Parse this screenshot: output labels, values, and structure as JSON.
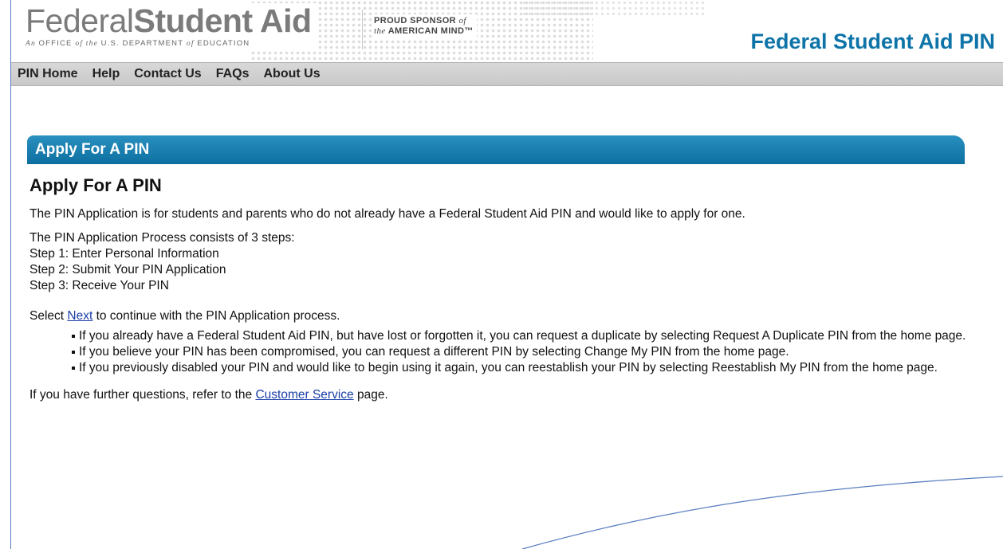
{
  "header": {
    "logo_federal": "Federal",
    "logo_student_aid": "Student Aid",
    "logo_subtitle_parts": [
      "An ",
      "OFFICE ",
      "of ",
      "the ",
      "U.S. DEPARTMENT ",
      "of ",
      "EDUCATION"
    ],
    "sponsor_line1": "PROUD SPONSOR",
    "sponsor_of": "of",
    "sponsor_line2_the": "the",
    "sponsor_line2": "AMERICAN MIND™",
    "site_title": "Federal Student Aid PIN"
  },
  "nav": {
    "items": [
      {
        "label": "PIN Home"
      },
      {
        "label": "Help"
      },
      {
        "label": "Contact Us"
      },
      {
        "label": "FAQs"
      },
      {
        "label": "About Us"
      }
    ]
  },
  "section": {
    "bar_title": "Apply For A PIN"
  },
  "main": {
    "heading": "Apply For A PIN",
    "intro": "The PIN Application is for students and parents who do not already have a Federal Student Aid PIN and would like to apply for one.",
    "process_intro": "The PIN Application Process consists of 3 steps:",
    "steps": [
      "Step 1: Enter Personal Information",
      "Step 2: Submit Your PIN Application",
      "Step 3: Receive Your PIN"
    ],
    "select_prefix": "Select ",
    "next_link": "Next",
    "select_suffix": " to continue with the PIN Application process.",
    "bullets": [
      "If you already have a Federal Student Aid PIN, but have lost or forgotten it, you can request a duplicate by selecting Request A Duplicate PIN from the home page.",
      "If you believe your PIN has been compromised, you can request a different PIN by selecting Change My PIN from the home page.",
      "If you previously disabled your PIN and would like to begin using it again, you can reestablish your PIN by selecting Reestablish My PIN from the home page."
    ],
    "further_prefix": "If you have further questions, refer to the ",
    "customer_service_link": "Customer Service",
    "further_suffix": " page."
  },
  "colors": {
    "accent_blue": "#0e74a8",
    "frame_line": "#5a7fc0",
    "link": "#1a3fa8"
  }
}
